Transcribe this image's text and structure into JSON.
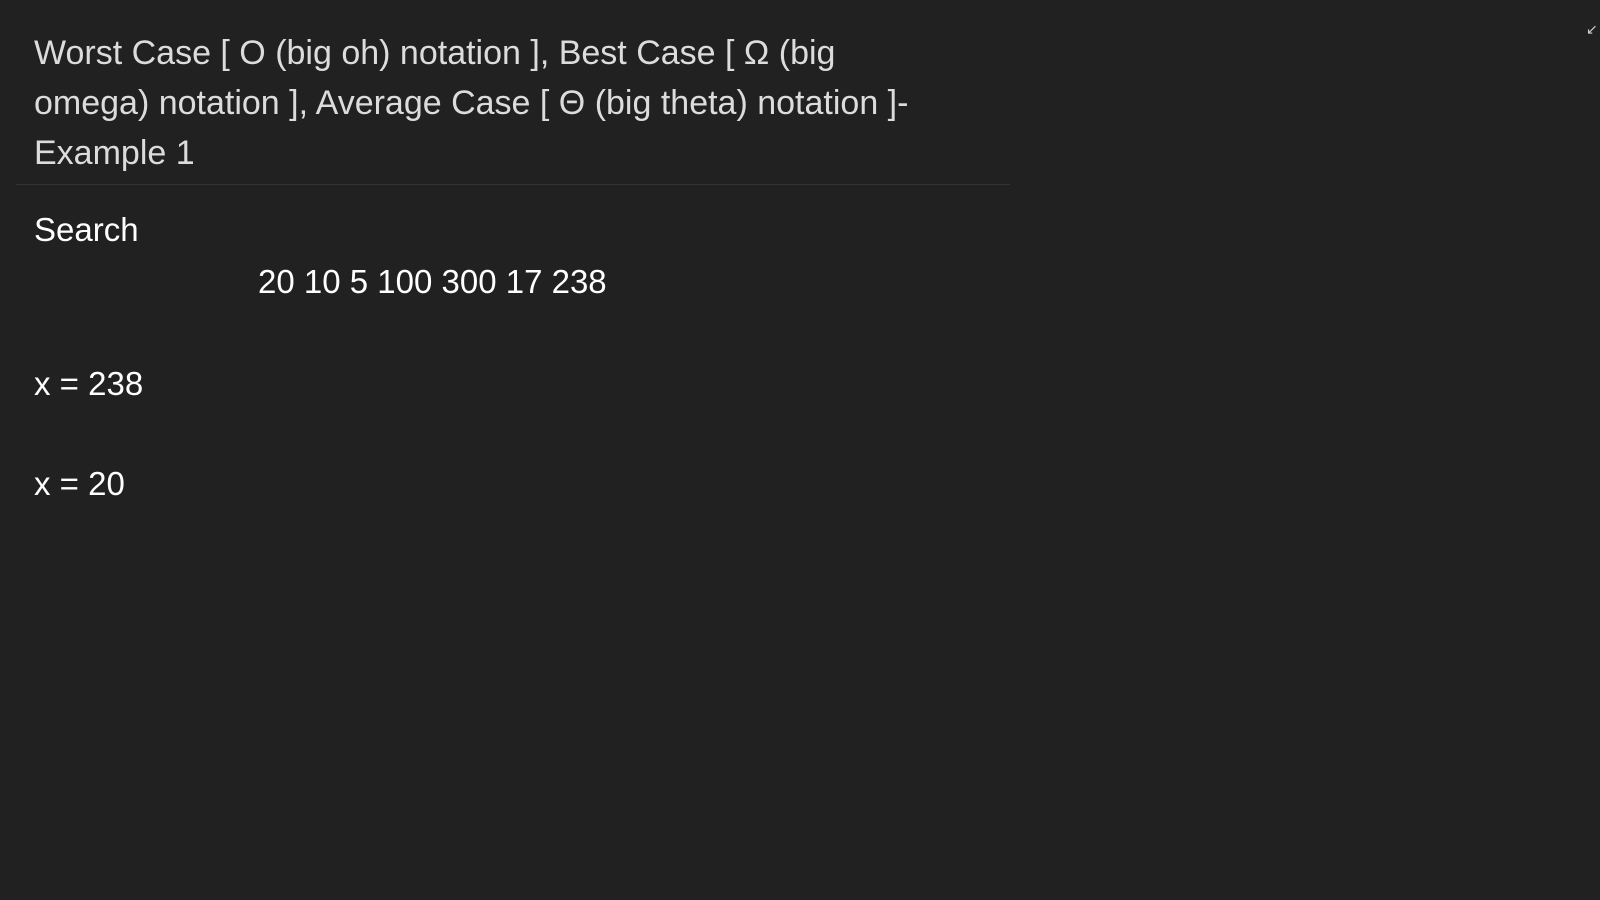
{
  "title": {
    "line1": "Worst Case [ O (big oh) notation ], Best Case [ Ω (big",
    "line2": "omega) notation ], Average Case [ Θ (big theta) notation ]-",
    "line3": "Example 1"
  },
  "section": {
    "heading": "Search",
    "array_text": "20 10 5 100 300 17 238"
  },
  "examples": [
    {
      "text": "x = 238"
    },
    {
      "text": "x = 20"
    }
  ],
  "icons": {
    "corner": "collapse-arrow-icon"
  }
}
